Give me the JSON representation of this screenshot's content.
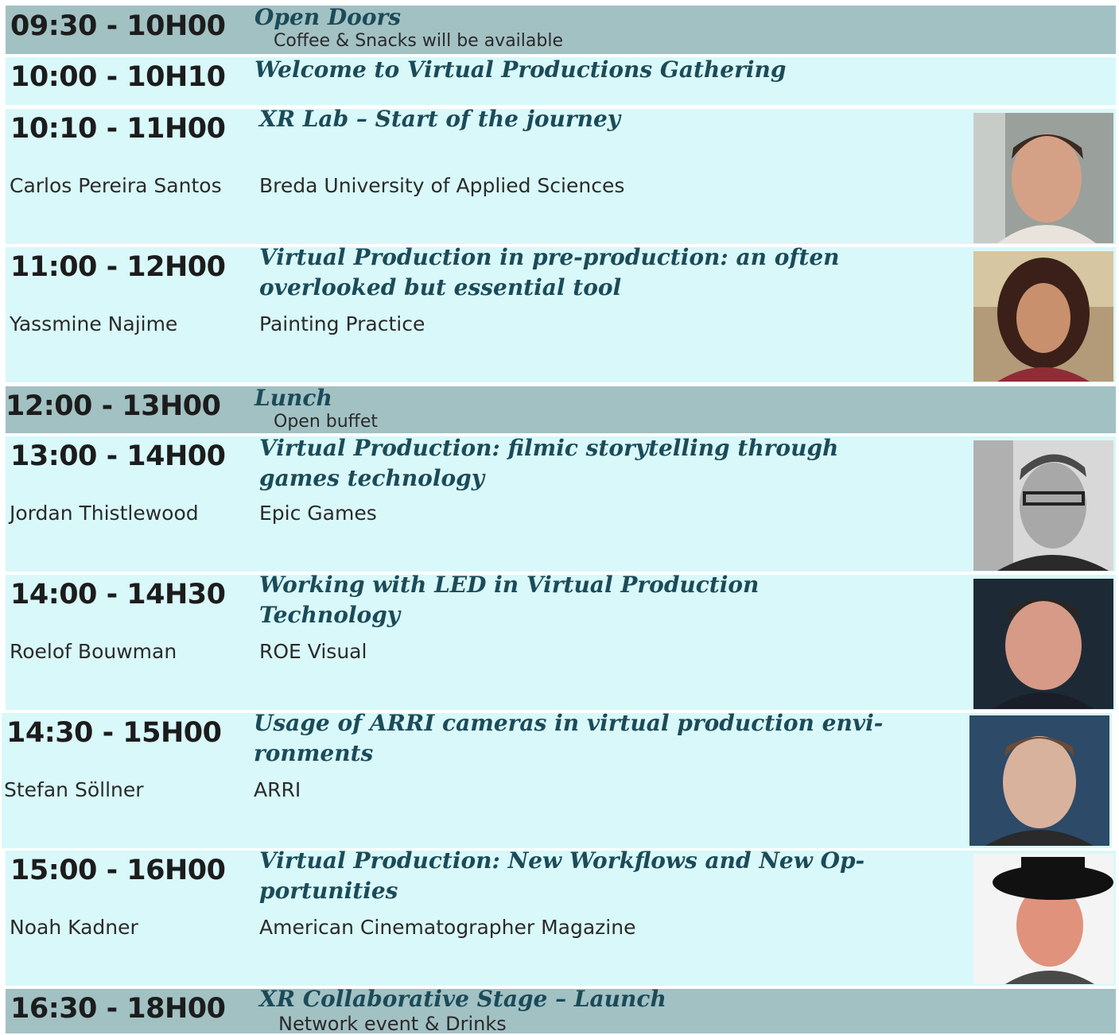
{
  "sessions": [
    {
      "time": "09:30 - 10H00",
      "title": "Open Doors",
      "subtitle": "Coffee & Snacks will be available"
    },
    {
      "time": "10:00 - 10H10",
      "title": "Welcome to Virtual Productions Gathering"
    },
    {
      "time": "10:10 - 11H00",
      "title": "XR Lab – Start of the journey",
      "speaker": "Carlos Pereira Santos",
      "org": "Breda University of Applied Sciences",
      "photo": "speaker-photo"
    },
    {
      "time": "11:00 - 12H00",
      "title_line1": "Virtual Production in pre-production: an often",
      "title_line2": "overlooked but essential tool",
      "speaker": "Yassmine Najime",
      "org": "Painting Practice",
      "photo": "speaker-photo"
    },
    {
      "time": "12:00 - 13H00",
      "title": "Lunch",
      "subtitle": "Open buffet"
    },
    {
      "time": "13:00 - 14H00",
      "title_line1": "Virtual Production: filmic storytelling through",
      "title_line2": "games technology",
      "speaker": "Jordan Thistlewood",
      "org": "Epic Games",
      "photo": "speaker-photo"
    },
    {
      "time": "14:00 - 14H30",
      "title_line1": "Working with LED in Virtual Production",
      "title_line2": "Technology",
      "speaker": "Roelof Bouwman",
      "org": "ROE Visual",
      "photo": "speaker-photo"
    },
    {
      "time": "14:30 - 15H00",
      "title_line1": "Usage of ARRI cameras in virtual production envi-",
      "title_line2": "ronments",
      "speaker": "Stefan Söllner",
      "org": "ARRI",
      "photo": "speaker-photo"
    },
    {
      "time": "15:00 - 16H00",
      "title_line1": "Virtual Production: New Workflows and New Op-",
      "title_line2": "portunities",
      "speaker": "Noah Kadner",
      "org": "American Cinematographer Magazine",
      "photo": "speaker-photo"
    },
    {
      "time": "16:30 - 18H00",
      "title": "XR Collaborative Stage – Launch",
      "subtitle": "Network event & Drinks"
    }
  ],
  "colors": {
    "break_bg": "#a2c1c3",
    "talk_bg": "#d9f8f9",
    "title": "#1b4b59",
    "time": "#1c1c1c"
  }
}
